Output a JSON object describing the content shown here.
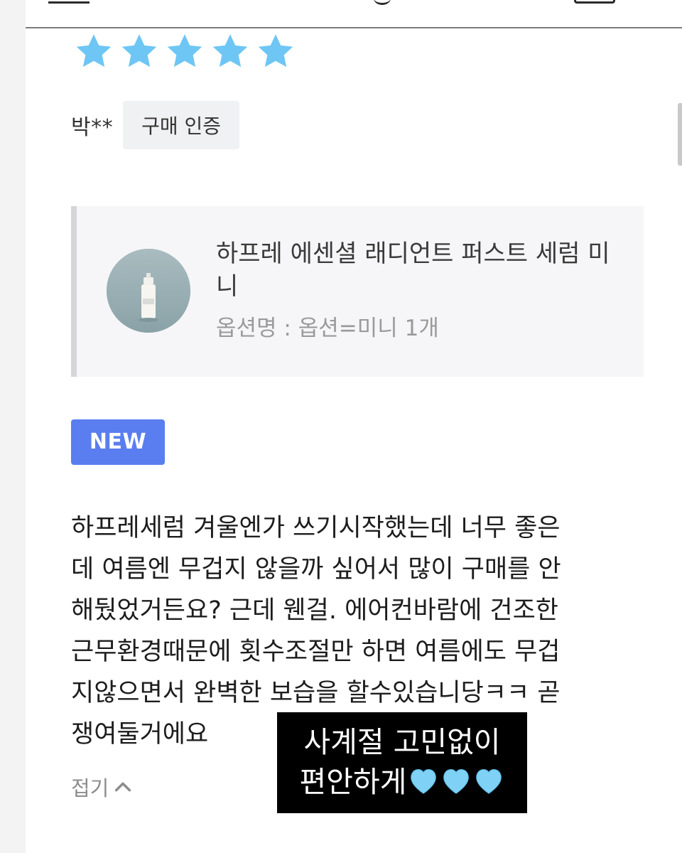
{
  "review": {
    "rating": 5,
    "rating_max": 5,
    "reviewer_name": "박**",
    "verified_label": "구매 인증",
    "badge": "NEW",
    "text": "하프레세럼 겨울엔가 쓰기시작했는데 너무 좋은\n데 여름엔 무겁지 않을까 싶어서 많이 구매를 안\n해뒀었거든요? 근데 웬걸. 에어컨바람에 건조한\n근무환경때문에 횟수조절만 하면 여름에도 무겁\n지않으면서 완벽한 보습을 할수있습니당ㅋㅋ 곧\n쟁여둘거에요",
    "collapse_label": "접기"
  },
  "product": {
    "name": "하프레 에센셜 래디언트 퍼스트 세럼 미니",
    "option": "옵션명 : 옵션=미니 1개"
  },
  "caption": {
    "line1": "사계절 고민없이",
    "line2": "편안하게"
  },
  "icons": {
    "star": "star-icon",
    "chevron": "chevron-up-icon",
    "heart": "light-blue-heart-icon"
  },
  "colors": {
    "star": "#6ec6f4",
    "new_badge": "#5a7ef0",
    "heart": "#7fd2f5",
    "caption_background": "#000000"
  }
}
